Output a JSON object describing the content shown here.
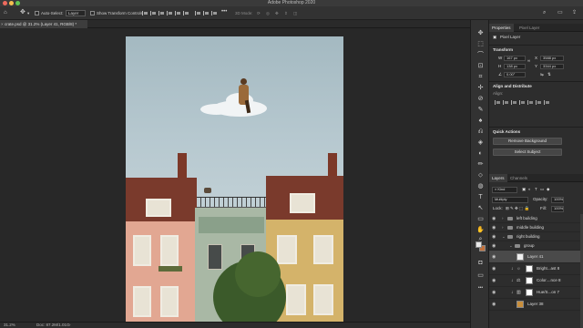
{
  "app": {
    "title": "Adobe Photoshop 2020"
  },
  "options_bar": {
    "auto_select_label": "Auto-Select:",
    "auto_select_value": "Layer",
    "show_transform_label": "Show Transform Controls",
    "mode_3d_label": "3D Mode:",
    "more_label": "•••"
  },
  "document": {
    "tab_label": "crate.psd @ 31.2% (Layer 41, RGB/8) *",
    "close_label": "×"
  },
  "status_bar": {
    "zoom": "31.2%",
    "doc_size": "Doc: 87.2M/1.01G"
  },
  "toolbar": {
    "tools": [
      "✥",
      "⬚",
      "⌒",
      "⊡",
      "⌗",
      "✢",
      "⊘",
      "✎",
      "♠",
      "⎌",
      "◈",
      "◐",
      "✏",
      "⬦",
      "◍",
      "T",
      "↖",
      "▭",
      "✋",
      "⌕",
      "•••"
    ],
    "foreground_color": "#e8e8e8",
    "background_color": "#c0703c"
  },
  "properties_panel": {
    "tabs": [
      "Properties",
      "Pixel Layer"
    ],
    "kind_label": "Pixel Layer",
    "transform_section": "Transform",
    "w_label": "W",
    "w_value": "167 px",
    "h_label": "H",
    "h_value": "138 px",
    "x_label": "X",
    "x_value": "3588 px",
    "y_label": "Y",
    "y_value": "3344 px",
    "angle_value": "0.00°",
    "align_section": "Align and Distribute",
    "align_label": "Align:",
    "quick_actions_section": "Quick Actions",
    "remove_bg_button": "Remove Background",
    "select_subject_button": "Select Subject"
  },
  "layers_panel": {
    "tabs": [
      "Layers",
      "Channels"
    ],
    "filter_label": "Kind",
    "blend_mode": "Multiply",
    "opacity_label": "Opacity:",
    "opacity_value": "100%",
    "lock_label": "Lock:",
    "fill_label": "Fill:",
    "fill_value": "100%",
    "layers": [
      {
        "name": "left building",
        "type": "group",
        "indent": 0
      },
      {
        "name": "middle building",
        "type": "group",
        "indent": 0
      },
      {
        "name": "right building",
        "type": "group",
        "indent": 0
      },
      {
        "name": "group",
        "type": "group",
        "indent": 1
      },
      {
        "name": "Layer 41",
        "type": "pixel",
        "indent": 2,
        "selected": true
      },
      {
        "name": "Bright...ast 8",
        "type": "adjustment",
        "indent": 2
      },
      {
        "name": "Color....nce 8",
        "type": "adjustment",
        "indent": 2
      },
      {
        "name": "Hue/S...on 7",
        "type": "adjustment",
        "indent": 2
      },
      {
        "name": "Layer 38",
        "type": "pixel",
        "indent": 2
      }
    ]
  },
  "colors": {
    "accent": "#3d8ee8",
    "panel_bg": "#2d2d2d",
    "canvas_bg": "#282828"
  }
}
